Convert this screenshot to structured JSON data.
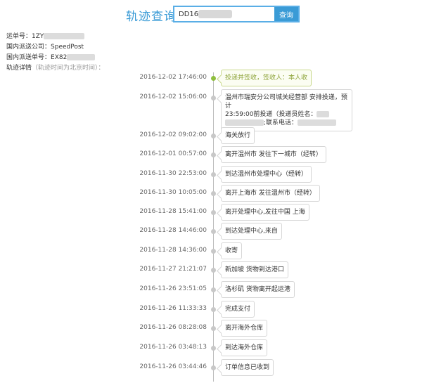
{
  "header": {
    "title": "轨迹查询",
    "search_value": "DD16",
    "search_button": "查询"
  },
  "info": {
    "waybill_label": "运单号：",
    "waybill_value": "1ZY",
    "courier_label": "国内派送公司：",
    "courier_value": "SpeedPost",
    "domestic_no_label": "国内派送单号：",
    "domestic_no_value": "EX82",
    "details_label": "轨迹详情",
    "details_note": "（轨迹时间为北京时间）："
  },
  "events": [
    {
      "time": "2016-12-02 17:46:00",
      "text": "投递并签收，签收人：本人收"
    },
    {
      "time": "2016-12-02 15:06:00",
      "line1": "温州市瑞安分公司城关经营部 安排投递，预计",
      "line2": "23:59:00前投递（投递员姓名：",
      "line3": ";联系电话："
    },
    {
      "time": "2016-12-02 09:02:00",
      "text": "海关放行"
    },
    {
      "time": "2016-12-01 00:57:00",
      "text": "离开温州市 发往下一城市（经转）"
    },
    {
      "time": "2016-11-30 22:53:00",
      "text": "到达温州市处理中心（经转）"
    },
    {
      "time": "2016-11-30 10:05:00",
      "text": "离开上海市 发往温州市（经转）"
    },
    {
      "time": "2016-11-28 15:41:00",
      "text": "离开处理中心,发往中国 上海"
    },
    {
      "time": "2016-11-28 14:46:00",
      "text": "到达处理中心,来自"
    },
    {
      "time": "2016-11-28 14:36:00",
      "text": "收寄"
    },
    {
      "time": "2016-11-27 21:21:07",
      "text": "新加坡 货物到达港口"
    },
    {
      "time": "2016-11-26 23:51:05",
      "text": "洛杉矶 货物离开起运港"
    },
    {
      "time": "2016-11-26 11:33:33",
      "text": "完成支付"
    },
    {
      "time": "2016-11-26 08:28:08",
      "text": "离开海外仓库"
    },
    {
      "time": "2016-11-26 03:48:13",
      "text": "到达海外仓库"
    },
    {
      "time": "2016-11-26 03:44:46",
      "text": "订单信息已收到"
    }
  ]
}
